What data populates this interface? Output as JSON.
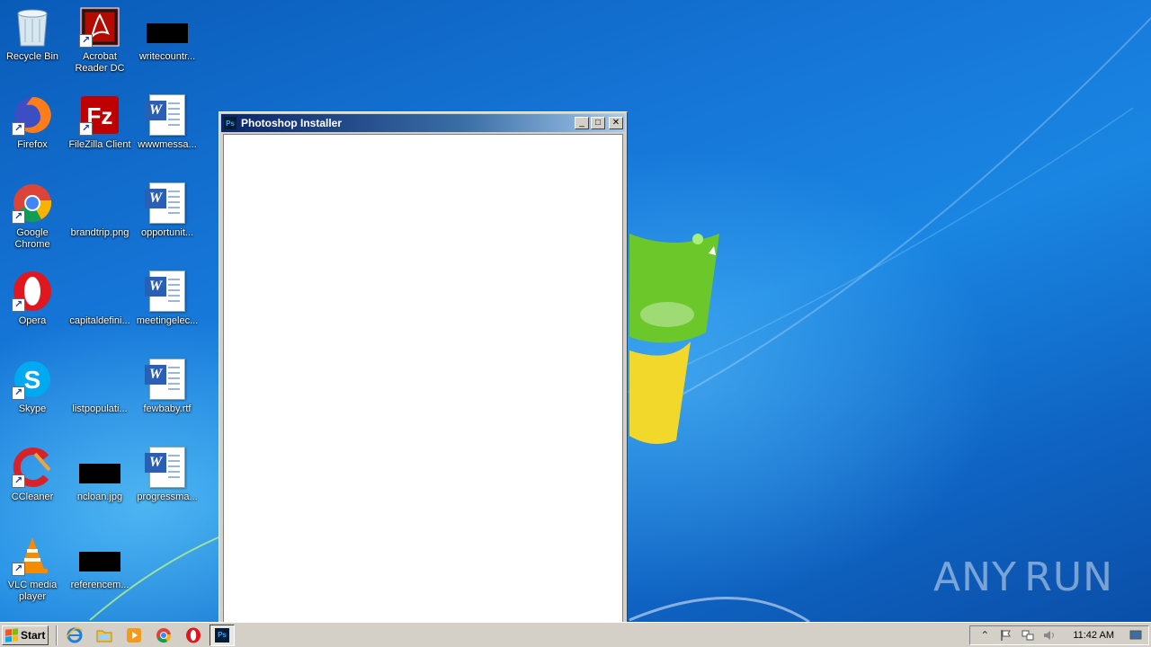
{
  "desktop": {
    "icons": [
      {
        "label": "Recycle Bin",
        "icon": "recycle-bin-icon"
      },
      {
        "label": "Acrobat Reader DC",
        "icon": "acrobat-reader-icon"
      },
      {
        "label": "writecountr...",
        "icon": "black-image-icon"
      },
      {
        "label": "Firefox",
        "icon": "firefox-icon"
      },
      {
        "label": "FileZilla Client",
        "icon": "filezilla-icon"
      },
      {
        "label": "wwwmessa...",
        "icon": "word-document-icon"
      },
      {
        "label": "Google Chrome",
        "icon": "chrome-icon"
      },
      {
        "label": "brandtrip.png",
        "icon": "image-file-icon"
      },
      {
        "label": "opportunit...",
        "icon": "word-document-icon"
      },
      {
        "label": "Opera",
        "icon": "opera-icon"
      },
      {
        "label": "capitaldefini...",
        "icon": "image-file-icon"
      },
      {
        "label": "meetingelec...",
        "icon": "word-document-icon"
      },
      {
        "label": "Skype",
        "icon": "skype-icon"
      },
      {
        "label": "listpopulati...",
        "icon": "image-file-icon"
      },
      {
        "label": "fewbaby.rtf",
        "icon": "word-document-icon"
      },
      {
        "label": "CCleaner",
        "icon": "ccleaner-icon"
      },
      {
        "label": "ncloan.jpg",
        "icon": "black-image-icon"
      },
      {
        "label": "progressma...",
        "icon": "word-document-icon"
      },
      {
        "label": "VLC media player",
        "icon": "vlc-icon"
      },
      {
        "label": "referencem...",
        "icon": "black-image-icon"
      }
    ],
    "watermark": "ANY RUN"
  },
  "window": {
    "title": "Photoshop Installer",
    "app_icon_text": "Ps",
    "minimize_glyph": "_",
    "maximize_glyph": "□",
    "close_glyph": "✕"
  },
  "taskbar": {
    "start_label": "Start",
    "quicklaunch": [
      "internet-explorer-icon",
      "explorer-folder-icon",
      "media-player-icon",
      "chrome-icon",
      "opera-icon"
    ],
    "active_task_icon_text": "Ps",
    "clock": "11:42 AM"
  }
}
